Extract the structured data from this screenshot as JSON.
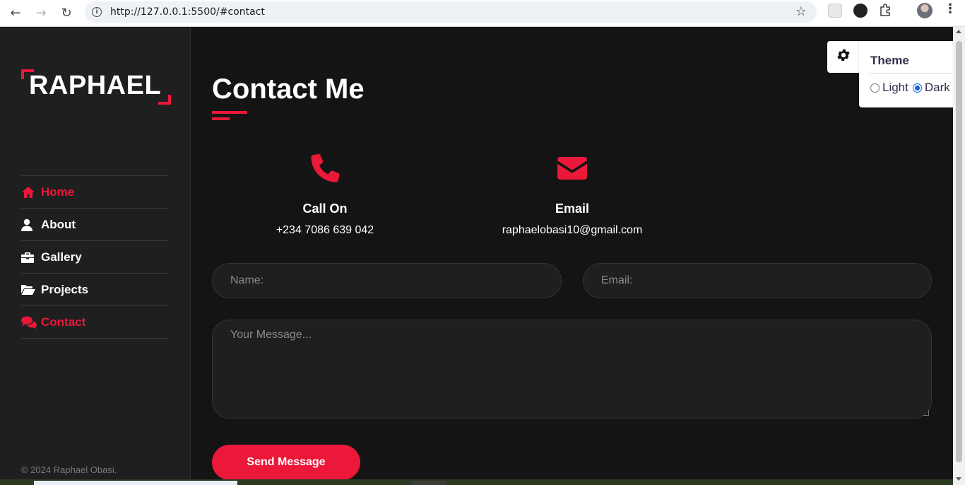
{
  "browser": {
    "url": "http://127.0.0.1:5500/#contact"
  },
  "sidebar": {
    "logo": "RAPHAEL",
    "nav": [
      {
        "label": "Home",
        "icon": "home-icon",
        "active": true
      },
      {
        "label": "About",
        "icon": "user-icon",
        "active": false
      },
      {
        "label": "Gallery",
        "icon": "briefcase-icon",
        "active": false
      },
      {
        "label": "Projects",
        "icon": "folder-open-icon",
        "active": false
      },
      {
        "label": "Contact",
        "icon": "comments-icon",
        "active": true
      }
    ],
    "copyright": "© 2024 Raphael Obasi."
  },
  "main": {
    "title": "Contact Me",
    "call": {
      "label": "Call On",
      "value": "+234 7086 639 042",
      "icon": "phone-icon"
    },
    "email": {
      "label": "Email",
      "value": "raphaelobasi10@gmail.com",
      "icon": "envelope-icon"
    },
    "form": {
      "name_placeholder": "Name:",
      "email_placeholder": "Email:",
      "message_placeholder": "Your Message...",
      "submit_label": "Send Message"
    }
  },
  "theme": {
    "title": "Theme",
    "options": [
      "Light",
      "Dark"
    ],
    "selected": "Dark"
  },
  "colors": {
    "accent": "#ec1839",
    "sidebar_bg": "#1f1f1f",
    "main_bg": "#141414",
    "theme_text": "#302e4d"
  }
}
